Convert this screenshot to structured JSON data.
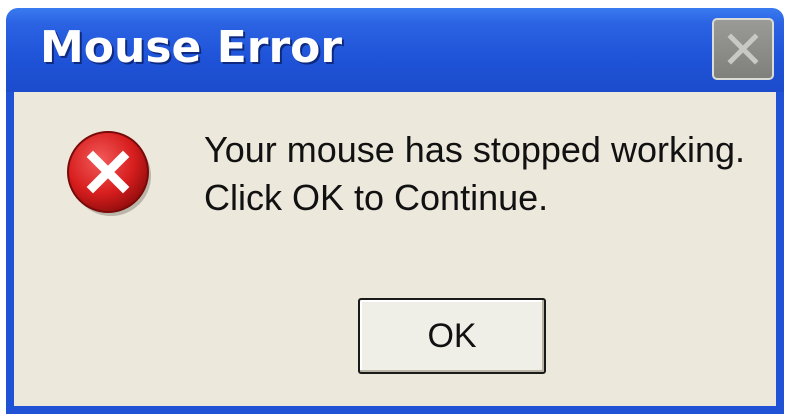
{
  "window": {
    "title": "Mouse Error",
    "close_icon": "close-icon"
  },
  "message": {
    "icon": "error-icon",
    "line1": "Your mouse has stopped working.",
    "line2": "Click OK to Continue."
  },
  "buttons": {
    "ok_label": "OK"
  },
  "colors": {
    "titlebar": "#1f53d8",
    "body": "#ece8dc",
    "error_red": "#d81e1e"
  }
}
